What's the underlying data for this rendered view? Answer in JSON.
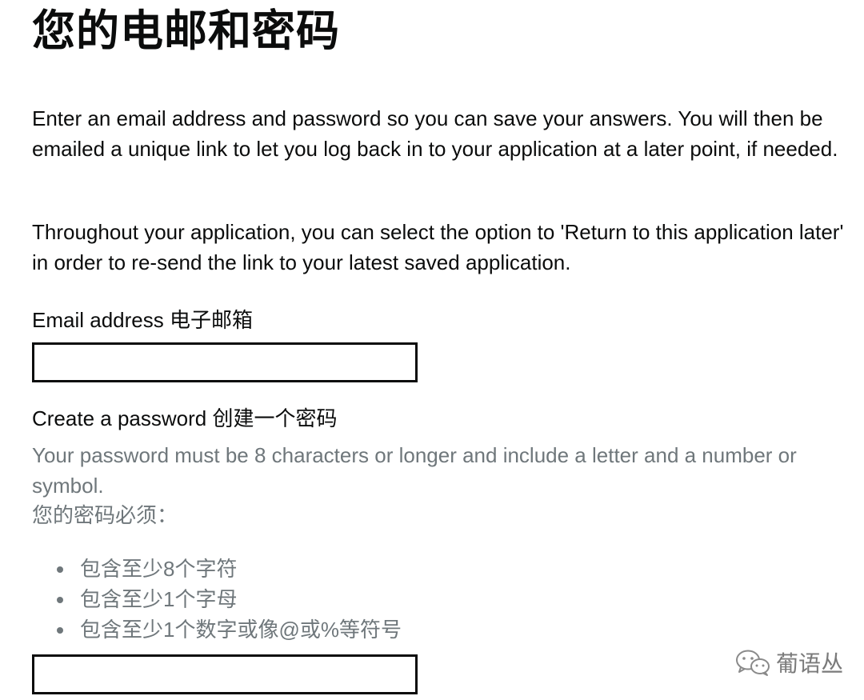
{
  "page": {
    "title": "您的电邮和密码",
    "intro_paragraph": "Enter an email address and password so you can save your answers. You will then be emailed a unique link to let you log back in to your application at a later point, if needed.",
    "return_paragraph": "Throughout your application, you can select the option to 'Return to this application later' in order to re-send the link to your latest saved application."
  },
  "email": {
    "label": "Email address 电子邮箱",
    "value": ""
  },
  "password": {
    "label": "Create a password 创建一个密码",
    "hint_en": "Your password must be 8 characters or longer and include a letter and a number or symbol.",
    "hint_zh": "您的密码必须：",
    "rules": [
      "包含至少8个字符",
      "包含至少1个字母",
      "包含至少1个数字或像@或%等符号"
    ],
    "value": ""
  },
  "watermark": {
    "icon": "wechat-icon",
    "text": "葡语丛"
  },
  "colors": {
    "text": "#0b0c0c",
    "hint": "#6f777b",
    "input_border": "#0b0c0c",
    "background": "#ffffff"
  }
}
